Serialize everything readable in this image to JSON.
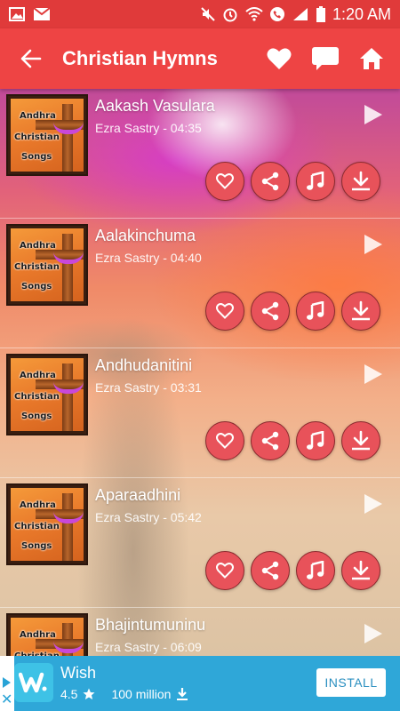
{
  "status_bar": {
    "time": "1:20 AM",
    "left_icons": [
      "image-icon",
      "mail-icon"
    ],
    "right_icons": [
      "mute-icon",
      "alarm-icon",
      "wifi-icon",
      "phone-icon",
      "signal-icon",
      "battery-icon"
    ]
  },
  "app_bar": {
    "title": "Christian Hymns",
    "back_icon": "back-arrow-icon",
    "actions": [
      "heart-icon",
      "chat-icon",
      "home-icon"
    ]
  },
  "thumbnail_text": {
    "line1": "Andhra",
    "line2": "Christian",
    "line3": "Songs"
  },
  "songs": [
    {
      "title": "Aakash Vasulara",
      "subtitle": "Ezra Sastry - 04:35"
    },
    {
      "title": "Aalakinchuma",
      "subtitle": "Ezra Sastry - 04:40"
    },
    {
      "title": "Andhudanitini",
      "subtitle": "Ezra Sastry - 03:31"
    },
    {
      "title": "Aparaadhini",
      "subtitle": "Ezra Sastry - 05:42"
    },
    {
      "title": "Bhajintumuninu",
      "subtitle": "Ezra Sastry - 06:09"
    }
  ],
  "row_buttons": [
    "favorite-icon",
    "share-icon",
    "music-note-icon",
    "download-icon"
  ],
  "ad": {
    "app_name": "Wish",
    "rating": "4.5",
    "installs": "100 million",
    "install_label": "INSTALL"
  },
  "colors": {
    "status_bar": "#e03a3a",
    "app_bar": "#ee4444",
    "circle_button": "#e8525a",
    "ad_background": "#2fa7d8"
  }
}
